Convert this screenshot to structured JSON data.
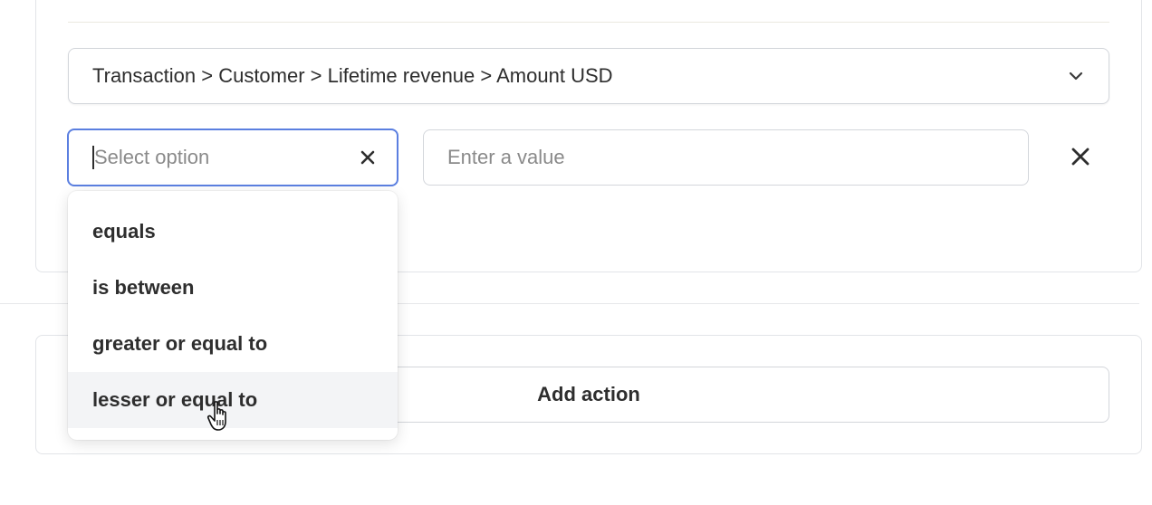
{
  "condition": {
    "field_path": "Transaction > Customer > Lifetime revenue > Amount USD",
    "operator_placeholder": "Select option",
    "value_placeholder": "Enter a value"
  },
  "operator_menu": {
    "items": [
      {
        "label": "equals"
      },
      {
        "label": "is between"
      },
      {
        "label": "greater or equal to"
      },
      {
        "label": "lesser or equal to"
      }
    ],
    "hovered_index": 3
  },
  "actions": {
    "add_action_label": "Add action"
  },
  "icons": {
    "field_chevron": "chevron-down-icon",
    "operator_clear": "close-icon",
    "remove_condition": "close-icon",
    "cursor": "hand-pointer-icon"
  },
  "colors": {
    "focus_border": "#5b7fe0",
    "hover_bg": "#f3f4f6"
  }
}
